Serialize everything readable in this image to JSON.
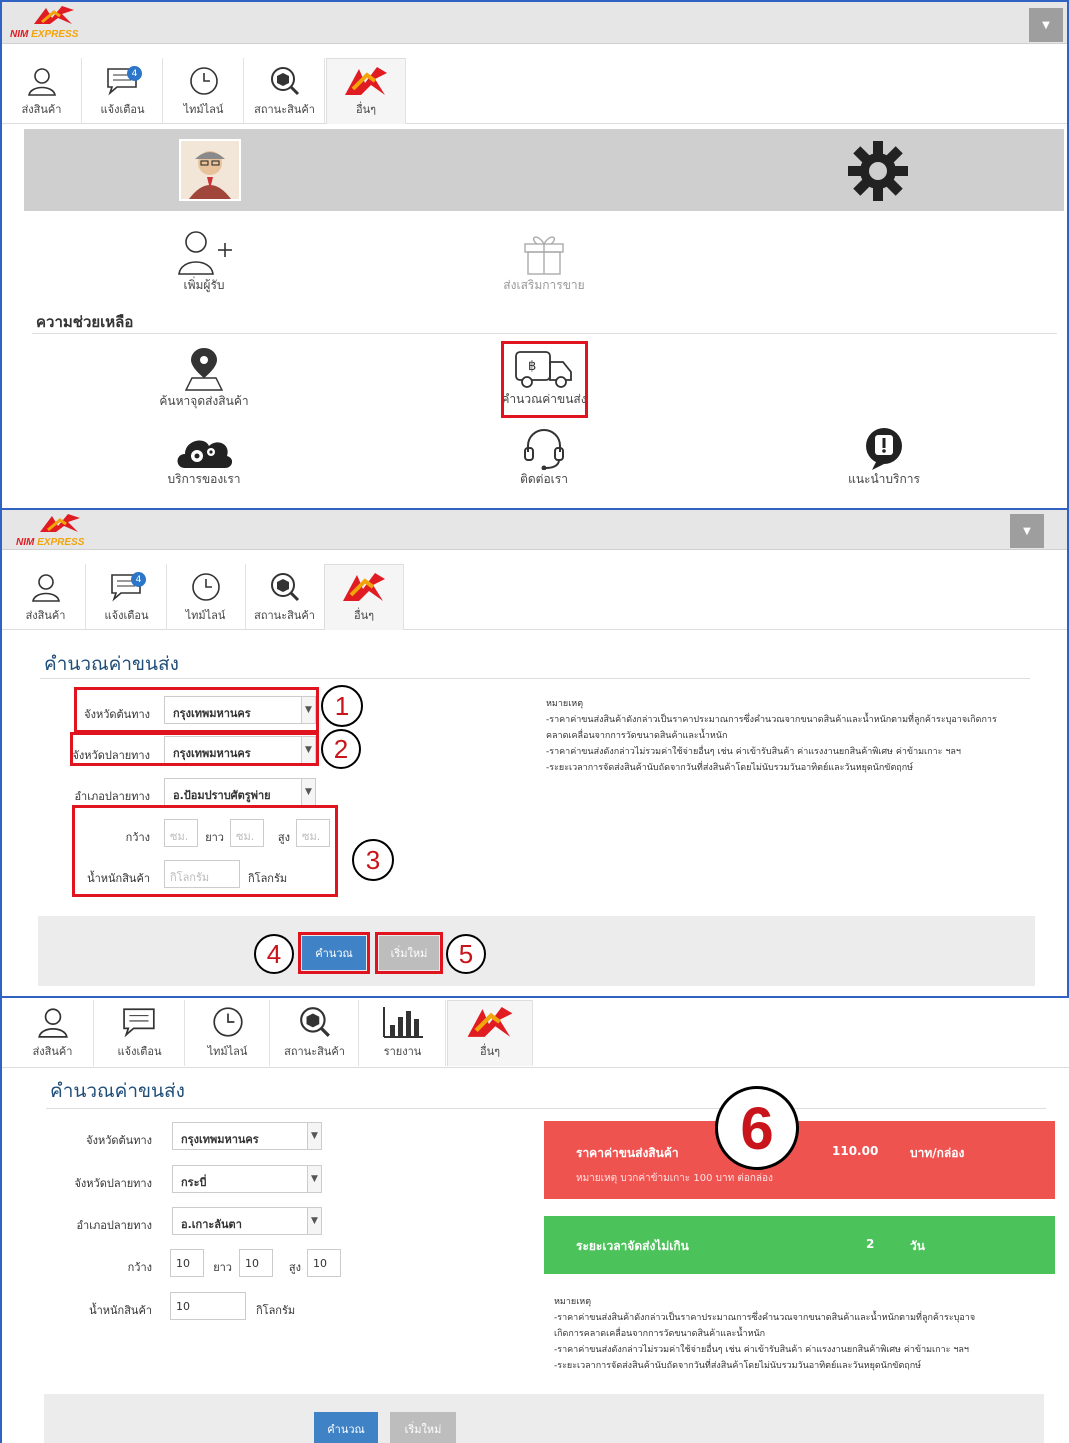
{
  "brand": {
    "name": "NIM",
    "suffix": "EXPRESS"
  },
  "tabs": {
    "send": "ส่งสินค้า",
    "notify": "แจ้งเตือน",
    "timeline": "ไทม์ไลน์",
    "status": "สถานะสินค้า",
    "report": "รายงาน",
    "other": "อื่นๆ",
    "badge": "4"
  },
  "menu": {
    "add_receiver": "เพิ่มผู้รับ",
    "promo": "ส่งเสริมการขาย",
    "help_title": "ความช่วยเหลือ",
    "find_point": "ค้นหาจุดส่งสินค้า",
    "calc": "คำนวณค่าขนส่ง",
    "services": "บริการของเรา",
    "contact": "ติดต่อเรา",
    "recommend": "แนะนำบริการ"
  },
  "form": {
    "title": "คำนวณค่าขนส่ง",
    "origin_label": "จังหวัดต้นทาง",
    "dest_label": "จังหวัดปลายทาง",
    "district_label": "อำเภอปลายทาง",
    "width_label": "กว้าง",
    "length_label": "ยาว",
    "height_label": "สูง",
    "weight_label": "น้ำหนักสินค้า",
    "weight_unit": "กิโลกรัม",
    "cm_placeholder": "ซม.",
    "kg_placeholder": "กิโลกรัม",
    "calc_button": "คำนวณ",
    "reset_button": "เริ่มใหม่"
  },
  "empty": {
    "origin": "กรุงเทพมหานคร",
    "dest": "กรุงเทพมหานคร",
    "district": "อ.ป้อมปราบศัตรูพ่าย"
  },
  "filled": {
    "origin": "กรุงเทพมหานคร",
    "dest": "กระบี่",
    "district": "อ.เกาะลันตา",
    "width": "10",
    "length": "10",
    "height": "10",
    "weight": "10"
  },
  "notes": {
    "title": "หมายเหตุ",
    "l1": "-ราคาค่าขนส่งสินค้าดังกล่าวเป็นราคาประมาณการซึ่งคำนวณจากขนาดสินค้าและน้ำหนักตามที่ลูกค้าระบุอาจเกิดการ",
    "l1b": "คลาดเคลื่อนจากการวัดขนาดสินค้าและน้ำหนัก",
    "l1_p3": "-ราคาค่าขนส่งสินค้าดังกล่าวเป็นราคาประมาณการซึ่งคำนวณจากขนาดสินค้าและน้ำหนักตามที่ลูกค้าระบุอาจ",
    "l1b_p3": "เกิดการคลาดเคลื่อนจากการวัดขนาดสินค้าและน้ำหนัก",
    "l2": "-ราคาค่าขนส่งดังกล่าวไม่รวมค่าใช้จ่ายอื่นๆ เช่น ค่าเข้ารับสินค้า ค่าแรงงานยกสินค้าพิเศษ ค่าข้ามเกาะ ฯลฯ",
    "l3": "-ระยะเวลาการจัดส่งสินค้านับถัดจากวันที่ส่งสินค้าโดยไม่นับรวมวันอาทิตย์และวันหยุดนักขัตฤกษ์"
  },
  "result": {
    "price_label": "ราคาค่าขนส่งสินค้า",
    "price": "110.00",
    "price_unit": "บาท/กล่อง",
    "price_note": "หมายเหตุ บวกค่าข้ามเกาะ 100 บาท ต่อกล่อง",
    "duration_label": "ระยะเวลาจัดส่งไม่เกิน",
    "duration": "2",
    "duration_unit": "วัน"
  },
  "steps": {
    "s1": "1",
    "s2": "2",
    "s3": "3",
    "s4": "4",
    "s5": "5",
    "s6": "6"
  },
  "colors": {
    "accent": "#3f82c6",
    "highlight": "#e0141e",
    "price_bg": "#ef5350",
    "duration_bg": "#4cc35a",
    "title": "#1f4e79"
  }
}
